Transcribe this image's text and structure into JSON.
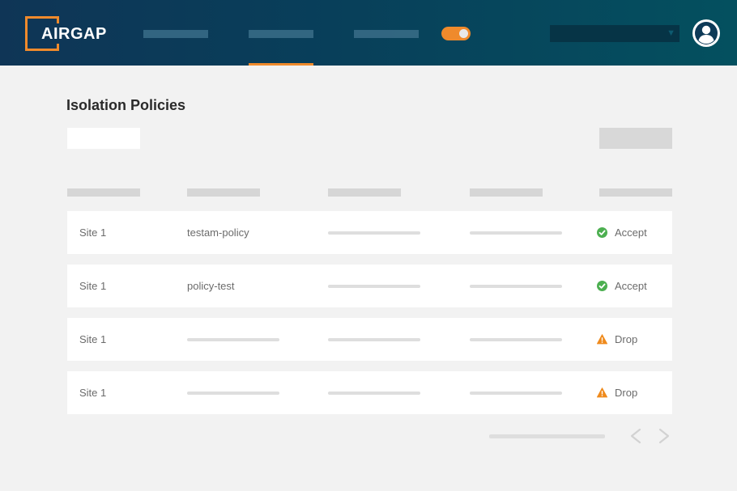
{
  "app": {
    "logo_text": "AIRGAP"
  },
  "header": {
    "nav_items": [
      "",
      "",
      ""
    ],
    "active_nav_index": 1,
    "toggle_on": true,
    "select_value": ""
  },
  "page": {
    "title": "Isolation Policies"
  },
  "table": {
    "rows": [
      {
        "site": "Site 1",
        "policy": "testam-policy",
        "status": "Accept",
        "status_type": "success"
      },
      {
        "site": "Site 1",
        "policy": "policy-test",
        "status": "Accept",
        "status_type": "success"
      },
      {
        "site": "Site 1",
        "policy": "",
        "status": "Drop",
        "status_type": "warning"
      },
      {
        "site": "Site 1",
        "policy": "",
        "status": "Drop",
        "status_type": "warning"
      }
    ]
  },
  "colors": {
    "accent": "#ef8a2c",
    "success": "#4caf50",
    "warning": "#ef8a1c",
    "header_start": "#0f3556",
    "header_end": "#04505f"
  },
  "icons": {
    "logo": "bracket-logo-icon",
    "profile": "user-avatar-icon",
    "select": "caret-down-icon",
    "success": "check-circle-icon",
    "warning": "warning-triangle-icon",
    "prev": "chevron-left-icon",
    "next": "chevron-right-icon"
  }
}
